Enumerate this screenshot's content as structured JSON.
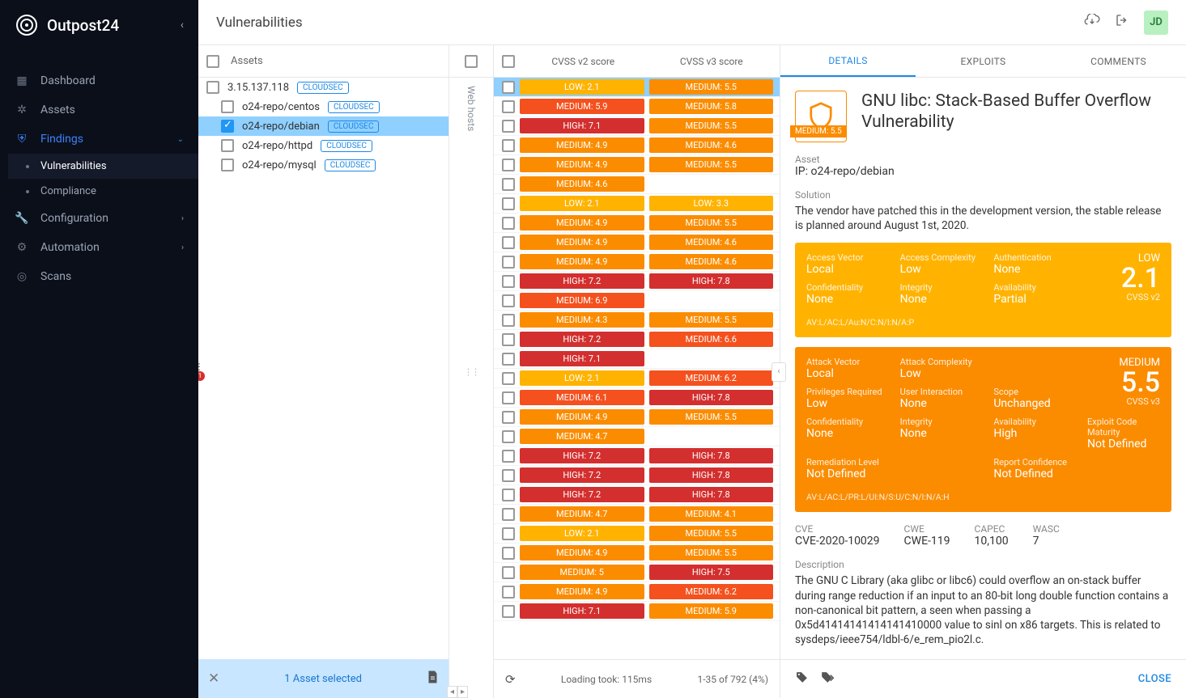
{
  "brand": "Outpost24",
  "page_title": "Vulnerabilities",
  "avatar": "JD",
  "sidebar": {
    "items": [
      {
        "id": "nav-dashboard",
        "label": "Dashboard",
        "chev": ""
      },
      {
        "id": "nav-assets",
        "label": "Assets",
        "chev": ""
      },
      {
        "id": "nav-findings",
        "label": "Findings",
        "chev": "⌄",
        "active": true,
        "children": [
          {
            "id": "nav-vulnerabilities",
            "label": "Vulnerabilities",
            "selected": true
          },
          {
            "id": "nav-compliance",
            "label": "Compliance"
          }
        ]
      },
      {
        "id": "nav-configuration",
        "label": "Configuration",
        "chev": "›"
      },
      {
        "id": "nav-automation",
        "label": "Automation",
        "chev": "›"
      },
      {
        "id": "nav-scans",
        "label": "Scans",
        "chev": ""
      }
    ]
  },
  "assets": {
    "header": "Assets",
    "items": [
      {
        "label": "3.15.137.118",
        "tag": "CLOUDSEC",
        "indent": 0,
        "checked": false
      },
      {
        "label": "o24-repo/centos",
        "tag": "CLOUDSEC",
        "indent": 1,
        "checked": false
      },
      {
        "label": "o24-repo/debian",
        "tag": "CLOUDSEC",
        "indent": 1,
        "checked": true,
        "selected": true
      },
      {
        "label": "o24-repo/httpd",
        "tag": "CLOUDSEC",
        "indent": 1,
        "checked": false
      },
      {
        "label": "o24-repo/mysql",
        "tag": "CLOUDSEC",
        "indent": 1,
        "checked": false
      }
    ],
    "filter_count": "1",
    "footer": "1 Asset selected"
  },
  "webhosts_label": "Web hosts",
  "vulns": {
    "col_v2": "CVSS v2 score",
    "col_v3": "CVSS v3 score",
    "rows": [
      {
        "v2": "LOW: 2.1",
        "c2": "low",
        "v3": "MEDIUM: 5.5",
        "c3": "medium",
        "sel": true
      },
      {
        "v2": "MEDIUM: 5.9",
        "c2": "high-m",
        "v3": "MEDIUM: 5.8",
        "c3": "medium"
      },
      {
        "v2": "HIGH: 7.1",
        "c2": "high",
        "v3": "MEDIUM: 5.5",
        "c3": "medium"
      },
      {
        "v2": "MEDIUM: 4.9",
        "c2": "medium",
        "v3": "MEDIUM: 4.6",
        "c3": "medium"
      },
      {
        "v2": "MEDIUM: 4.9",
        "c2": "medium",
        "v3": "MEDIUM: 5.5",
        "c3": "medium"
      },
      {
        "v2": "MEDIUM: 4.6",
        "c2": "medium",
        "v3": "",
        "c3": "empty"
      },
      {
        "v2": "LOW: 2.1",
        "c2": "low",
        "v3": "LOW: 3.3",
        "c3": "low"
      },
      {
        "v2": "MEDIUM: 4.9",
        "c2": "medium",
        "v3": "MEDIUM: 5.5",
        "c3": "medium"
      },
      {
        "v2": "MEDIUM: 4.9",
        "c2": "medium",
        "v3": "MEDIUM: 4.6",
        "c3": "medium"
      },
      {
        "v2": "MEDIUM: 4.9",
        "c2": "medium",
        "v3": "MEDIUM: 4.6",
        "c3": "medium"
      },
      {
        "v2": "HIGH: 7.2",
        "c2": "high",
        "v3": "HIGH: 7.8",
        "c3": "high"
      },
      {
        "v2": "MEDIUM: 6.9",
        "c2": "high-m",
        "v3": "",
        "c3": "empty"
      },
      {
        "v2": "MEDIUM: 4.3",
        "c2": "medium",
        "v3": "MEDIUM: 5.5",
        "c3": "medium"
      },
      {
        "v2": "HIGH: 7.2",
        "c2": "high",
        "v3": "MEDIUM: 6.6",
        "c3": "high-m"
      },
      {
        "v2": "HIGH: 7.1",
        "c2": "high",
        "v3": "",
        "c3": "empty"
      },
      {
        "v2": "LOW: 2.1",
        "c2": "low",
        "v3": "MEDIUM: 6.2",
        "c3": "high-m"
      },
      {
        "v2": "MEDIUM: 6.1",
        "c2": "high-m",
        "v3": "HIGH: 7.8",
        "c3": "high"
      },
      {
        "v2": "MEDIUM: 4.9",
        "c2": "medium",
        "v3": "MEDIUM: 5.5",
        "c3": "medium"
      },
      {
        "v2": "MEDIUM: 4.7",
        "c2": "medium",
        "v3": "",
        "c3": "empty"
      },
      {
        "v2": "HIGH: 7.2",
        "c2": "high",
        "v3": "HIGH: 7.8",
        "c3": "high"
      },
      {
        "v2": "HIGH: 7.2",
        "c2": "high",
        "v3": "HIGH: 7.8",
        "c3": "high"
      },
      {
        "v2": "HIGH: 7.2",
        "c2": "high",
        "v3": "HIGH: 7.8",
        "c3": "high"
      },
      {
        "v2": "MEDIUM: 4.7",
        "c2": "medium",
        "v3": "MEDIUM: 4.1",
        "c3": "medium"
      },
      {
        "v2": "LOW: 2.1",
        "c2": "low",
        "v3": "MEDIUM: 5.5",
        "c3": "medium"
      },
      {
        "v2": "MEDIUM: 4.9",
        "c2": "medium",
        "v3": "MEDIUM: 5.5",
        "c3": "medium"
      },
      {
        "v2": "MEDIUM: 5",
        "c2": "medium",
        "v3": "HIGH: 7.5",
        "c3": "high"
      },
      {
        "v2": "MEDIUM: 4.9",
        "c2": "medium",
        "v3": "MEDIUM: 6.2",
        "c3": "high-m"
      },
      {
        "v2": "HIGH: 7.1",
        "c2": "high",
        "v3": "MEDIUM: 5.9",
        "c3": "medium"
      }
    ],
    "loading": "Loading took: 115ms",
    "range": "1-35 of 792 (4%)"
  },
  "details": {
    "tabs": [
      "DETAILS",
      "EXPLOITS",
      "COMMENTS"
    ],
    "badge": "MEDIUM: 5.5",
    "title": "GNU libc: Stack-Based Buffer Overflow Vulnerability",
    "asset_label": "Asset",
    "asset_value": "IP: o24-repo/debian",
    "solution_label": "Solution",
    "solution_value": "The vendor have patched this in the development version, the stable release is planned around August 1st, 2020.",
    "v2": {
      "level": "LOW",
      "score": "2.1",
      "tag": "CVSS v2",
      "metrics": [
        {
          "l": "Access Vector",
          "v": "Local"
        },
        {
          "l": "Access Complexity",
          "v": "Low"
        },
        {
          "l": "Authentication",
          "v": "None"
        },
        {
          "l": "Confidentiality",
          "v": "None"
        },
        {
          "l": "Integrity",
          "v": "None"
        },
        {
          "l": "Availability",
          "v": "Partial"
        }
      ],
      "vec": "AV:L/AC:L/Au:N/C:N/I:N/A:P"
    },
    "v3": {
      "level": "MEDIUM",
      "score": "5.5",
      "tag": "CVSS v3",
      "metrics": [
        {
          "l": "Attack Vector",
          "v": "Local"
        },
        {
          "l": "Attack Complexity",
          "v": "Low"
        },
        {
          "l": "",
          "v": ""
        },
        {
          "l": "Privileges Required",
          "v": "Low"
        },
        {
          "l": "User Interaction",
          "v": "None"
        },
        {
          "l": "Scope",
          "v": "Unchanged"
        },
        {
          "l": "Confidentiality",
          "v": "None"
        },
        {
          "l": "Integrity",
          "v": "None"
        },
        {
          "l": "Availability",
          "v": "High"
        },
        {
          "l": "Exploit Code Maturity",
          "v": "Not Defined"
        },
        {
          "l": "Remediation Level",
          "v": "Not Defined"
        },
        {
          "l": "",
          "v": ""
        },
        {
          "l": "Report Confidence",
          "v": "Not Defined"
        }
      ],
      "vec": "AV:L/AC:L/PR:L/UI:N/S:U/C:N/I:N/A:H"
    },
    "refs": [
      {
        "l": "CVE",
        "v": "CVE-2020-10029"
      },
      {
        "l": "CWE",
        "v": "CWE-119"
      },
      {
        "l": "CAPEC",
        "v": "10,100"
      },
      {
        "l": "WASC",
        "v": "7"
      }
    ],
    "desc_label": "Description",
    "desc": "The GNU C Library (aka glibc or libc6) could overflow an on-stack buffer during range reduction if an input to an 80-bit long double function contains a non-canonical bit pattern, a seen when passing a 0x5d41414141414141410000 value to sinl on x86 targets. This is related to sysdeps/ieee754/ldbl-6/e_rem_pio2l.c.",
    "close": "CLOSE"
  }
}
